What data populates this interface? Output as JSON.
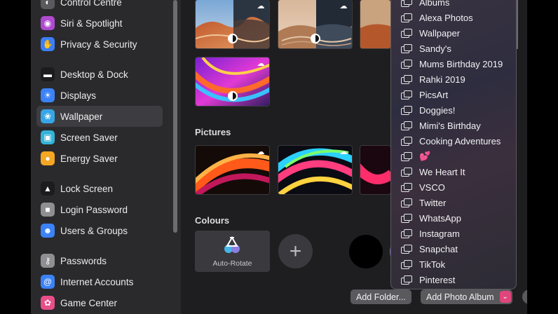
{
  "sidebar": {
    "items": [
      {
        "label": "Control Centre",
        "icon": "control-centre-icon",
        "color": "#5a5a5e",
        "glyph": "◐"
      },
      {
        "label": "Siri & Spotlight",
        "icon": "siri-icon",
        "color": "#b04ad0",
        "glyph": "◉"
      },
      {
        "label": "Privacy & Security",
        "icon": "hand-icon",
        "color": "#3b7ff5",
        "glyph": "✋"
      },
      {
        "label": "Desktop & Dock",
        "icon": "dock-icon",
        "color": "#1c1c1e",
        "glyph": "▬"
      },
      {
        "label": "Displays",
        "icon": "sun-icon",
        "color": "#3b82f6",
        "glyph": "☀"
      },
      {
        "label": "Wallpaper",
        "icon": "flower-icon",
        "color": "#36a6e8",
        "glyph": "❀"
      },
      {
        "label": "Screen Saver",
        "icon": "screen-saver-icon",
        "color": "#34b3d8",
        "glyph": "▣"
      },
      {
        "label": "Energy Saver",
        "icon": "bulb-icon",
        "color": "#f5a623",
        "glyph": "●"
      },
      {
        "label": "Lock Screen",
        "icon": "lock-icon",
        "color": "#1c1c1e",
        "glyph": "▲"
      },
      {
        "label": "Login Password",
        "icon": "padlock-icon",
        "color": "#8e8e93",
        "glyph": "■"
      },
      {
        "label": "Users & Groups",
        "icon": "users-icon",
        "color": "#3b82f6",
        "glyph": "☻"
      },
      {
        "label": "Passwords",
        "icon": "key-icon",
        "color": "#8e8e93",
        "glyph": "⚷"
      },
      {
        "label": "Internet Accounts",
        "icon": "at-icon",
        "color": "#3b82f6",
        "glyph": "@"
      },
      {
        "label": "Game Center",
        "icon": "game-center-icon",
        "color": "#e84e8a",
        "glyph": "✿"
      }
    ],
    "active": "Wallpaper"
  },
  "main": {
    "pictures_title": "Pictures",
    "colours_title": "Colours",
    "auto_rotate_label": "Auto-Rotate",
    "add_colour_glyph": "+",
    "colour_swatches": [
      "#000000",
      "#6b64b8"
    ]
  },
  "footer": {
    "add_folder": "Add Folder...",
    "add_photo_album": "Add Photo Album",
    "help": "?"
  },
  "menu": {
    "items": [
      "Albums",
      "Alexa Photos",
      "Wallpaper",
      "Sandy's",
      "Mums Birthday 2019",
      "Rahki 2019",
      "PicsArt",
      "Doggies!",
      "Mimi's Birthday",
      "Cooking Adventures",
      "💕",
      "We Heart It",
      "VSCO",
      "Twitter",
      "WhatsApp",
      "Instagram",
      "Snapchat",
      "TikTok",
      "Pinterest"
    ]
  },
  "colors": {
    "accent": "#e0457b",
    "sidebar_bg": "#2a2a2d",
    "main_bg": "#1e1e20"
  }
}
